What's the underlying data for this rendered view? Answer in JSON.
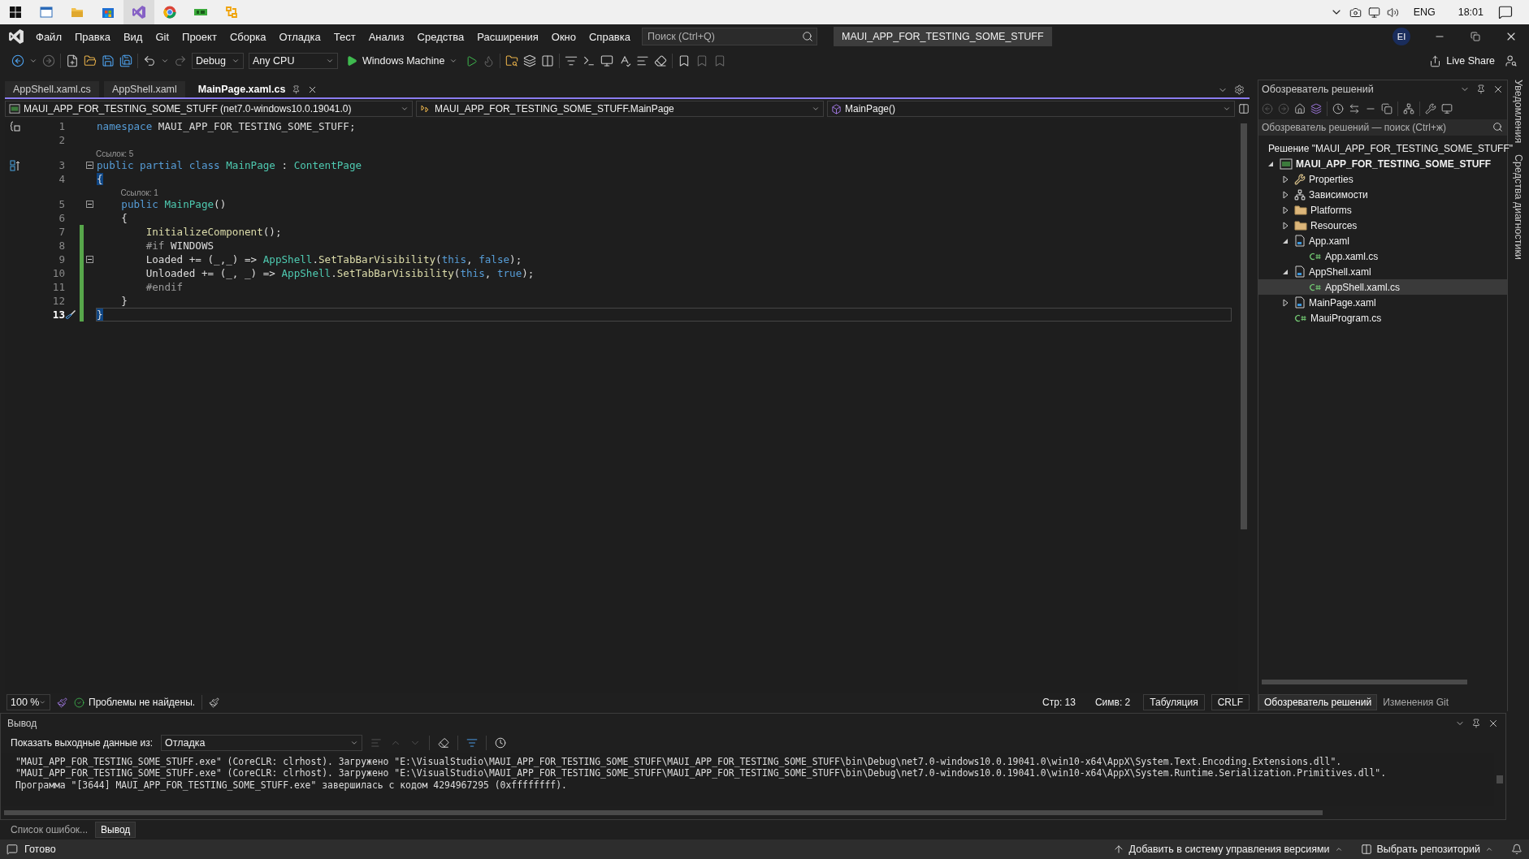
{
  "taskbar": {
    "language": "ENG",
    "time": "18:01"
  },
  "menu_bar": {
    "items": [
      "Файл",
      "Правка",
      "Вид",
      "Git",
      "Проект",
      "Сборка",
      "Отладка",
      "Тест",
      "Анализ",
      "Средства",
      "Расширения",
      "Окно",
      "Справка"
    ],
    "search": {
      "placeholder": "Поиск (Ctrl+Q)"
    },
    "solution_name": "MAUI_APP_FOR_TESTING_SOME_STUFF",
    "account_initials": "EI"
  },
  "toolbar": {
    "configuration": "Debug",
    "platform": "Any CPU",
    "run_target": "Windows Machine",
    "live_share": "Live Share"
  },
  "document_tabs": [
    {
      "label": "AppShell.xaml.cs",
      "selected": false
    },
    {
      "label": "AppShell.xaml",
      "selected": false
    },
    {
      "label": "MainPage.xaml.cs",
      "selected": true
    }
  ],
  "navigation_bar": {
    "project": "MAUI_APP_FOR_TESTING_SOME_STUFF (net7.0-windows10.0.19041.0)",
    "type": "MAUI_APP_FOR_TESTING_SOME_STUFF.MainPage",
    "member": "MainPage()"
  },
  "code": {
    "lines": [
      {
        "number": "1",
        "changed": false,
        "fold": false,
        "current": false,
        "tokens": [
          {
            "kind": "keyword",
            "t": "namespace"
          },
          {
            "kind": "plain",
            "t": " MAUI_APP_FOR_TESTING_SOME_STUFF;"
          }
        ]
      },
      {
        "number": "2",
        "changed": false,
        "fold": false,
        "current": false
      },
      {
        "number": "3",
        "codelens": "Ссылок: 5",
        "changed": false,
        "fold": true,
        "current": false,
        "tokens": [
          {
            "kind": "keyword",
            "t": "public partial class "
          },
          {
            "kind": "type",
            "t": "MainPage"
          },
          {
            "kind": "plain",
            "t": " : "
          },
          {
            "kind": "type",
            "t": "ContentPage"
          }
        ]
      },
      {
        "number": "4",
        "changed": false,
        "fold": false,
        "current": false,
        "tokens": [
          {
            "kind": "match",
            "t": "{"
          }
        ]
      },
      {
        "number": "5",
        "codelens": "Ссылок: 1",
        "changed": false,
        "fold": true,
        "current": false,
        "tokens": [
          {
            "kind": "keyword",
            "t": "    public "
          },
          {
            "kind": "type",
            "t": "MainPage"
          },
          {
            "kind": "plain",
            "t": "()"
          }
        ]
      },
      {
        "number": "6",
        "changed": false,
        "fold": false,
        "current": false,
        "tokens": [
          {
            "kind": "plain",
            "t": "    {"
          }
        ]
      },
      {
        "number": "7",
        "changed": true,
        "fold": false,
        "current": false,
        "tokens": [
          {
            "kind": "method",
            "t": "        InitializeComponent"
          },
          {
            "kind": "plain",
            "t": "();"
          }
        ]
      },
      {
        "number": "8",
        "changed": true,
        "fold": false,
        "current": false,
        "tokens": [
          {
            "kind": "preproc",
            "t": "        #if"
          },
          {
            "kind": "plain",
            "t": " WINDOWS"
          }
        ]
      },
      {
        "number": "9",
        "changed": true,
        "fold": true,
        "current": false,
        "tokens": [
          {
            "kind": "plain",
            "t": "        Loaded += (_,_) => "
          },
          {
            "kind": "type",
            "t": "AppShell"
          },
          {
            "kind": "plain",
            "t": "."
          },
          {
            "kind": "method",
            "t": "SetTabBarVisibility"
          },
          {
            "kind": "plain",
            "t": "("
          },
          {
            "kind": "keyword",
            "t": "this"
          },
          {
            "kind": "plain",
            "t": ", "
          },
          {
            "kind": "keyword",
            "t": "false"
          },
          {
            "kind": "plain",
            "t": ");"
          }
        ]
      },
      {
        "number": "10",
        "changed": true,
        "fold": false,
        "current": false,
        "tokens": [
          {
            "kind": "plain",
            "t": "        Unloaded += (_, _) => "
          },
          {
            "kind": "type",
            "t": "AppShell"
          },
          {
            "kind": "plain",
            "t": "."
          },
          {
            "kind": "method",
            "t": "SetTabBarVisibility"
          },
          {
            "kind": "plain",
            "t": "("
          },
          {
            "kind": "keyword",
            "t": "this"
          },
          {
            "kind": "plain",
            "t": ", "
          },
          {
            "kind": "keyword",
            "t": "true"
          },
          {
            "kind": "plain",
            "t": ");"
          }
        ]
      },
      {
        "number": "11",
        "changed": true,
        "fold": false,
        "current": false,
        "tokens": [
          {
            "kind": "preproc",
            "t": "        #endif"
          }
        ]
      },
      {
        "number": "12",
        "changed": true,
        "fold": false,
        "current": false,
        "tokens": [
          {
            "kind": "plain",
            "t": "    }"
          }
        ]
      },
      {
        "number": "13",
        "changed": true,
        "fold": false,
        "current": true,
        "tokens": [
          {
            "kind": "match",
            "t": "}"
          }
        ]
      }
    ]
  },
  "editor_status": {
    "zoom": "100 %",
    "issues": "Проблемы не найдены.",
    "line": "Стр: 13",
    "column": "Симв: 2",
    "indent": "Табуляция",
    "line_ending": "CRLF"
  },
  "solution_explorer": {
    "title": "Обозреватель решений",
    "search": {
      "placeholder": "Обозреватель решений — поиск (Ctrl+ж)"
    },
    "tree": [
      {
        "label": "Решение \"MAUI_APP_FOR_TESTING_SOME_STUFF\"",
        "kind": "solution",
        "selected": false
      },
      {
        "label": "MAUI_APP_FOR_TESTING_SOME_STUFF",
        "kind": "project",
        "selected": false,
        "expanded": true,
        "children": [
          {
            "label": "Properties",
            "kind": "properties",
            "selected": false,
            "expanded": false
          },
          {
            "label": "Зависимости",
            "kind": "dependencies",
            "selected": false,
            "expanded": false
          },
          {
            "label": "Platforms",
            "kind": "folder",
            "selected": false,
            "expanded": false
          },
          {
            "label": "Resources",
            "kind": "folder",
            "selected": false,
            "expanded": false
          },
          {
            "label": "App.xaml",
            "kind": "xaml",
            "selected": false,
            "expanded": true,
            "children": [
              {
                "label": "App.xaml.cs",
                "kind": "csharp",
                "selected": false
              }
            ]
          },
          {
            "label": "AppShell.xaml",
            "kind": "xaml",
            "selected": false,
            "expanded": true,
            "children": [
              {
                "label": "AppShell.xaml.cs",
                "kind": "csharp",
                "selected": true
              }
            ]
          },
          {
            "label": "MainPage.xaml",
            "kind": "xaml",
            "selected": false,
            "expanded": false
          },
          {
            "label": "MauiProgram.cs",
            "kind": "csharp",
            "selected": false
          }
        ]
      }
    ],
    "tabs": [
      {
        "label": "Обозреватель решений",
        "selected": true
      },
      {
        "label": "Изменения Git",
        "selected": false
      }
    ]
  },
  "output": {
    "title": "Вывод",
    "source_label": "Показать выходные данные из:",
    "source": "Отладка",
    "lines": [
      "\"MAUI_APP_FOR_TESTING_SOME_STUFF.exe\" (CoreCLR: clrhost). Загружено \"E:\\VisualStudio\\MAUI_APP_FOR_TESTING_SOME_STUFF\\MAUI_APP_FOR_TESTING_SOME_STUFF\\bin\\Debug\\net7.0-windows10.0.19041.0\\win10-x64\\AppX\\System.Text.Encoding.Extensions.dll\".",
      "\"MAUI_APP_FOR_TESTING_SOME_STUFF.exe\" (CoreCLR: clrhost). Загружено \"E:\\VisualStudio\\MAUI_APP_FOR_TESTING_SOME_STUFF\\MAUI_APP_FOR_TESTING_SOME_STUFF\\bin\\Debug\\net7.0-windows10.0.19041.0\\win10-x64\\AppX\\System.Runtime.Serialization.Primitives.dll\".",
      "Программа \"[3644] MAUI_APP_FOR_TESTING_SOME_STUFF.exe\" завершилась с кодом 4294967295 (0xffffffff)."
    ]
  },
  "bottom_tabs": [
    {
      "label": "Список ошибок...",
      "selected": false
    },
    {
      "label": "Вывод",
      "selected": true
    }
  ],
  "status_bar": {
    "state": "Готово",
    "add_to_source_control": "Добавить в систему управления версиями",
    "select_repository": "Выбрать репозиторий"
  },
  "side_strip": [
    "Уведомления",
    "Средства диагностики"
  ]
}
